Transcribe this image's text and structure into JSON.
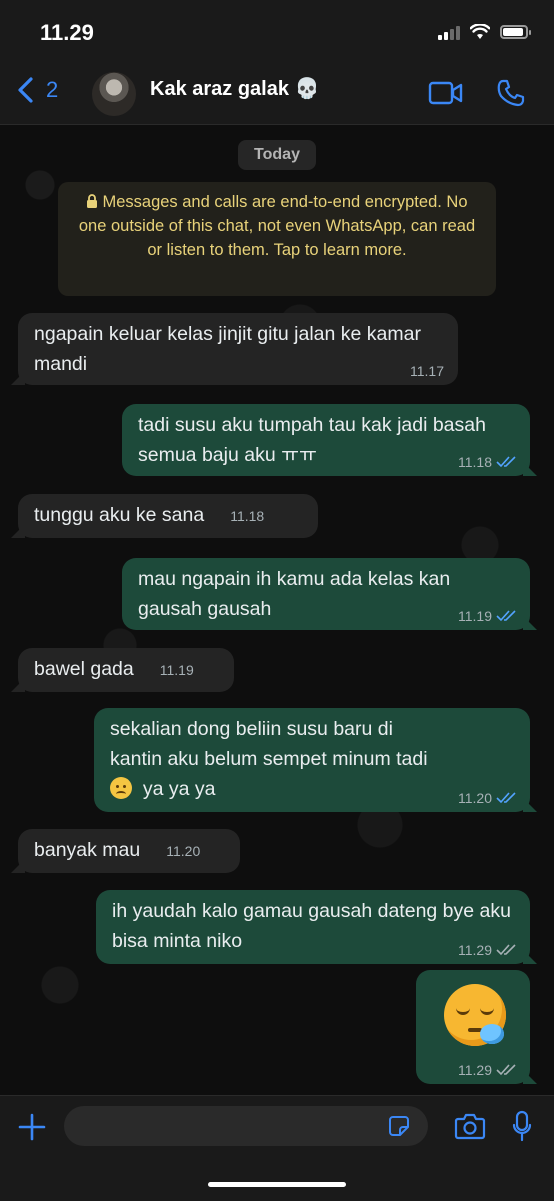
{
  "status_bar": {
    "time": "11.29"
  },
  "header": {
    "back_count": "2",
    "contact_name": "Kak araz galak 💀"
  },
  "chat": {
    "date_label": "Today",
    "encryption_notice": "Messages and calls are end-to-end encrypted. No one outside of this chat, not even WhatsApp, can read or listen to them. Tap to learn more.",
    "messages": [
      {
        "direction": "in",
        "text": "ngapain keluar kelas jinjit gitu jalan ke kamar mandi",
        "time": "11.17"
      },
      {
        "direction": "out",
        "text": "tadi susu aku tumpah tau kak jadi basah semua baju aku ㅠㅠ",
        "time": "11.18",
        "status": "read"
      },
      {
        "direction": "in",
        "text": "tunggu aku ke sana",
        "time": "11.18"
      },
      {
        "direction": "out",
        "text": "mau ngapain ih kamu ada kelas kan gausah gausah",
        "time": "11.19",
        "status": "read"
      },
      {
        "direction": "in",
        "text": "bawel gada",
        "time": "11.19"
      },
      {
        "direction": "out",
        "text_line1": "sekalian dong beliin susu baru di",
        "text_line2": "kantin aku belum sempet minum tadi",
        "text_line3": "ya ya ya",
        "time": "11.20",
        "status": "read"
      },
      {
        "direction": "in",
        "text": "banyak mau",
        "time": "11.20"
      },
      {
        "direction": "out",
        "text": "ih yaudah kalo gamau gausah dateng bye aku bisa minta niko",
        "time": "11.29",
        "status": "sent"
      },
      {
        "direction": "out",
        "emoji": "sleepy-face",
        "time": "11.29",
        "status": "sent"
      }
    ]
  },
  "input_bar": {
    "placeholder": ""
  },
  "colors": {
    "accent": "#3b87f5",
    "outgoing_bubble": "#1d4a3a",
    "incoming_bubble": "#242424",
    "read_ticks": "#53a3ff",
    "encryption_text": "#e8d27a"
  },
  "icons": [
    "back-chevron-icon",
    "video-call-icon",
    "phone-call-icon",
    "lock-icon",
    "double-check-icon",
    "plus-icon",
    "sticker-icon",
    "camera-icon",
    "microphone-icon"
  ]
}
